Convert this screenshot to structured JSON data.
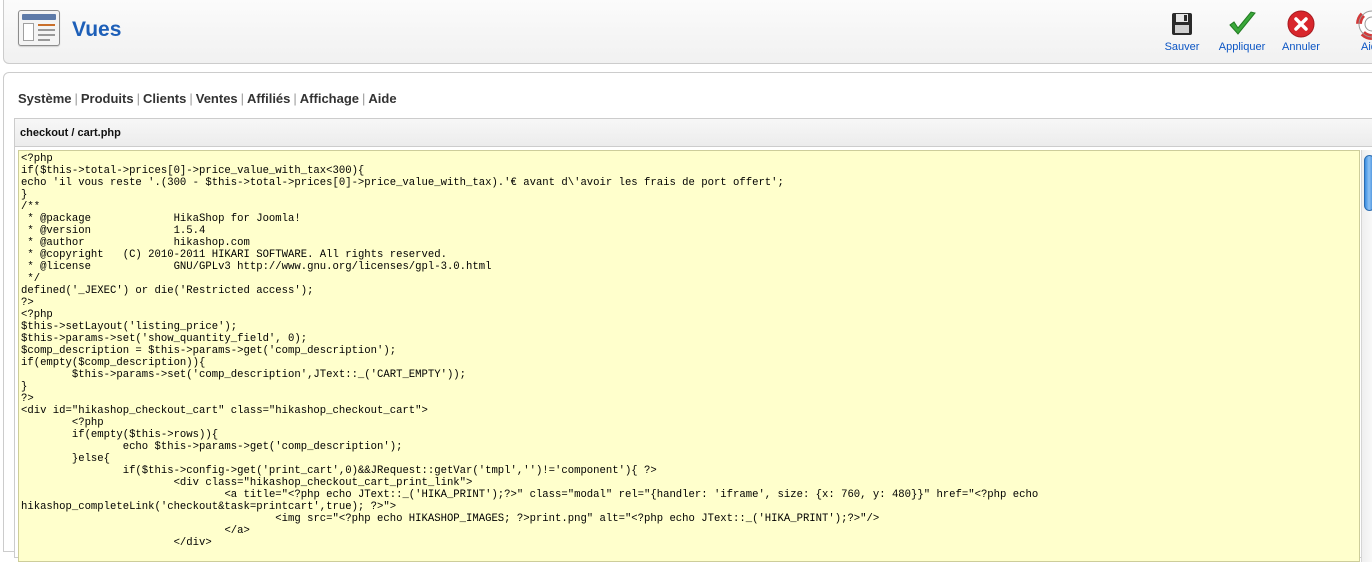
{
  "header": {
    "title": "Vues",
    "icon": "views-manager-icon"
  },
  "toolbar": {
    "buttons": [
      {
        "label": "Sauver",
        "icon": "floppy-disk-icon"
      },
      {
        "label": "Appliquer",
        "icon": "checkmark-icon"
      },
      {
        "label": "Annuler",
        "icon": "cancel-icon"
      },
      {
        "label": "Aide",
        "icon": "lifebuoy-icon"
      }
    ]
  },
  "menu": {
    "items": [
      "Système",
      "Produits",
      "Clients",
      "Ventes",
      "Affiliés",
      "Affichage",
      "Aide"
    ]
  },
  "file": {
    "path": "checkout / cart.php",
    "code": "<?php\nif($this->total->prices[0]->price_value_with_tax<300){\necho 'il vous reste '.(300 - $this->total->prices[0]->price_value_with_tax).'€ avant d\\'avoir les frais de port offert';\n}\n/**\n * @package\t\tHikaShop for Joomla!\n * @version\t\t1.5.4\n * @author\t\thikashop.com\n * @copyright\t(C) 2010-2011 HIKARI SOFTWARE. All rights reserved.\n * @license\t\tGNU/GPLv3 http://www.gnu.org/licenses/gpl-3.0.html\n */\ndefined('_JEXEC') or die('Restricted access');\n?>\n<?php\n$this->setLayout('listing_price');\n$this->params->set('show_quantity_field', 0);\n$comp_description = $this->params->get('comp_description');\nif(empty($comp_description)){\n\t$this->params->set('comp_description',JText::_('CART_EMPTY'));\n}\n?>\n<div id=\"hikashop_checkout_cart\" class=\"hikashop_checkout_cart\">\n\t<?php\n\tif(empty($this->rows)){\n\t\techo $this->params->get('comp_description');\n\t}else{\n\t\tif($this->config->get('print_cart',0)&&JRequest::getVar('tmpl','')!='component'){ ?>\n\t\t\t<div class=\"hikashop_checkout_cart_print_link\">\n\t\t\t\t<a title=\"<?php echo JText::_('HIKA_PRINT');?>\" class=\"modal\" rel=\"{handler: 'iframe', size: {x: 760, y: 480}}\" href=\"<?php echo\nhikashop_completeLink('checkout&task=printcart',true); ?>\">\n\t\t\t\t\t<img src=\"<?php echo HIKASHOP_IMAGES; ?>print.png\" alt=\"<?php echo JText::_('HIKA_PRINT');?>\"/>\n\t\t\t\t</a>\n\t\t\t</div>"
  }
}
